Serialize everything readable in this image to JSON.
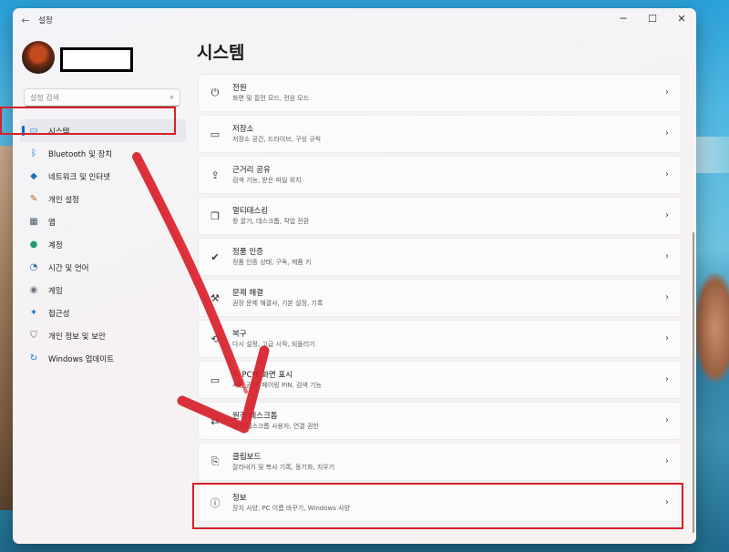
{
  "app_title": "설정",
  "window_controls": [
    "─",
    "☐",
    "✕"
  ],
  "search": {
    "placeholder": "설정 검색"
  },
  "sidebar": {
    "items": [
      {
        "label": "시스템",
        "icon": "monitor-icon",
        "glyph": "▭",
        "color": "#2a7fd4"
      },
      {
        "label": "Bluetooth 및 장치",
        "icon": "bluetooth-icon",
        "glyph": "ᛒ",
        "color": "#1e73c9"
      },
      {
        "label": "네트워크 및 인터넷",
        "icon": "wifi-icon",
        "glyph": "◆",
        "color": "#1a6fbf"
      },
      {
        "label": "개인 설정",
        "icon": "brush-icon",
        "glyph": "✎",
        "color": "#b35a1a"
      },
      {
        "label": "앱",
        "icon": "apps-icon",
        "glyph": "▦",
        "color": "#4a5a70"
      },
      {
        "label": "계정",
        "icon": "account-icon",
        "glyph": "●",
        "color": "#1f9b78"
      },
      {
        "label": "시간 및 언어",
        "icon": "clock-globe-icon",
        "glyph": "◔",
        "color": "#2a6fb5"
      },
      {
        "label": "게임",
        "icon": "gamepad-icon",
        "glyph": "◉",
        "color": "#6c7580"
      },
      {
        "label": "접근성",
        "icon": "accessibility-icon",
        "glyph": "✦",
        "color": "#1e73c9"
      },
      {
        "label": "개인 정보 및 보안",
        "icon": "shield-icon",
        "glyph": "⛉",
        "color": "#5a6470"
      },
      {
        "label": "Windows 업데이트",
        "icon": "update-icon",
        "glyph": "↻",
        "color": "#1e73c9"
      }
    ],
    "selected_index": 0
  },
  "main": {
    "title": "시스템",
    "cards": [
      {
        "title": "전원",
        "subtitle": "화면 및 절전 모드, 전원 모드",
        "icon": "power-icon",
        "glyph": "⏻"
      },
      {
        "title": "저장소",
        "subtitle": "저장소 공간, 드라이브, 구성 규칙",
        "icon": "storage-icon",
        "glyph": "▭"
      },
      {
        "title": "근거리 공유",
        "subtitle": "검색 기능, 받은 파일 위치",
        "icon": "share-icon",
        "glyph": "⇪"
      },
      {
        "title": "멀티태스킹",
        "subtitle": "창 끌기, 데스크톱, 작업 전환",
        "icon": "multitask-icon",
        "glyph": "❐"
      },
      {
        "title": "정품 인증",
        "subtitle": "정품 인증 상태, 구독, 제품 키",
        "icon": "check-circle-icon",
        "glyph": "✔"
      },
      {
        "title": "문제 해결",
        "subtitle": "권장 문제 해결사, 기본 설정, 기록",
        "icon": "wrench-icon",
        "glyph": "⚒"
      },
      {
        "title": "복구",
        "subtitle": "다시 설정, 고급 시작, 되돌리기",
        "icon": "recovery-icon",
        "glyph": "⟲"
      },
      {
        "title": "이 PC에 화면 표시",
        "subtitle": "사용 권한, 페어링 PIN, 검색 기능",
        "icon": "project-icon",
        "glyph": "▭"
      },
      {
        "title": "원격 데스크톱",
        "subtitle": "원격 데스크톱 사용자, 연결 권한",
        "icon": "remote-desktop-icon",
        "glyph": "⇄"
      },
      {
        "title": "클립보드",
        "subtitle": "잘라내기 및 복사 기록, 동기화, 지우기",
        "icon": "clipboard-icon",
        "glyph": "⎘"
      },
      {
        "title": "정보",
        "subtitle": "장치 사양, PC 이름 바꾸기, Windows 사양",
        "icon": "info-icon",
        "glyph": "ⓘ"
      }
    ]
  },
  "colors": {
    "accent": "#0067c0",
    "highlight_red": "#d6202a"
  }
}
